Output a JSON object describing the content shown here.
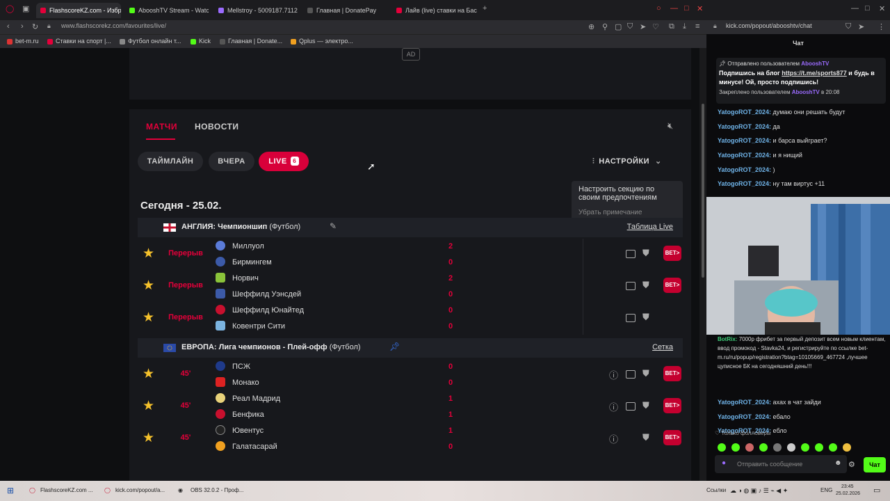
{
  "browser": {
    "tabs": [
      {
        "label": "FlashscoreKZ.com - Избр",
        "color": "#e4003a"
      },
      {
        "label": "AbooshTV Stream - Watc",
        "color": "#53fc18"
      },
      {
        "label": "Mellstroy - 5009187.71122",
        "color": "#9b6bff"
      },
      {
        "label": "Главная | DonatePay",
        "color": "#555"
      },
      {
        "label": "Лайв (live) ставки на Бас",
        "color": "#e4003a"
      }
    ],
    "address_left": "www.flashscorekz.com/favourites/live/",
    "address_right": "kick.com/popout/abooshtv/chat",
    "bookmarks": [
      {
        "label": "bet-m.ru",
        "color": "#d33"
      },
      {
        "label": "Ставки на спорт |...",
        "color": "#e4003a"
      },
      {
        "label": "Футбол онлайн т...",
        "color": "#888"
      },
      {
        "label": "Kick",
        "color": "#53fc18"
      },
      {
        "label": "Главная | Donate...",
        "color": "#555"
      },
      {
        "label": "Qplus — электро...",
        "color": "#f0a020"
      }
    ]
  },
  "site": {
    "ad_label": "AD",
    "nav": {
      "matches": "МАТЧИ",
      "news": "НОВОСТИ"
    },
    "filters": {
      "timeline": "ТАЙМЛАЙН",
      "yesterday": "ВЧЕРА",
      "live": "LIVE",
      "live_count": "6"
    },
    "settings_label": "НАСТРОЙКИ",
    "tooltip": {
      "text": "Настроить секцию по своим предпочтениям",
      "dismiss": "Убрать примечание"
    },
    "date_heading": "Сегодня - 25.02.",
    "leagues": [
      {
        "country": "АНГЛИЯ:",
        "name": "Чемпионшип",
        "sport": "(Футбол)",
        "link": "Таблица Live",
        "matches": [
          {
            "status": "Перерыв",
            "home": "Миллуол",
            "away": "Бирмингем",
            "home_score": "2",
            "away_score": "0",
            "bet": "BET>"
          },
          {
            "status": "Перерыв",
            "home": "Норвич",
            "away": "Шеффилд Уэнсдей",
            "home_score": "2",
            "away_score": "0",
            "bet": "BET>"
          },
          {
            "status": "Перерыв",
            "home": "Шеффилд Юнайтед",
            "away": "Ковентри Сити",
            "home_score": "0",
            "away_score": "0",
            "bet": ""
          }
        ]
      },
      {
        "country": "ЕВРОПА:",
        "name": "Лига чемпионов - Плей-офф",
        "sport": "(Футбол)",
        "link": "Сетка",
        "matches": [
          {
            "status": "45'",
            "home": "ПСЖ",
            "away": "Монако",
            "home_score": "0",
            "away_score": "0",
            "bet": "BET>"
          },
          {
            "status": "45'",
            "home": "Реал Мадрид",
            "away": "Бенфика",
            "home_score": "1",
            "away_score": "1",
            "bet": "BET>"
          },
          {
            "status": "45'",
            "home": "Ювентус",
            "away": "Галатасарай",
            "home_score": "1",
            "away_score": "0",
            "bet": "BET>"
          }
        ]
      }
    ]
  },
  "chat": {
    "title": "Чат",
    "pinned": {
      "sent_by": "Отправлено пользователем",
      "sent_user": "AbooshTV",
      "text_before": "Подпишись на блог",
      "link": "https://t.me/sports877",
      "text_after": "и будь в минусе! Ой, просто подпишись!",
      "pinned_by": "Закреплено пользователем",
      "pinned_user": "AbooshTV",
      "pinned_time": "в 20:08"
    },
    "messages_top": [
      {
        "user": "YatogoROT_2024:",
        "text": "думаю они решать будут"
      },
      {
        "user": "YatogoROT_2024:",
        "text": "да"
      },
      {
        "user": "YatogoROT_2024:",
        "text": "и барса выйграет?"
      },
      {
        "user": "YatogoROT_2024:",
        "text": "и я нищий"
      },
      {
        "user": "YatogoROT_2024:",
        "text": ")"
      },
      {
        "user": "YatogoROT_2024:",
        "text": "ну там виртус +11"
      }
    ],
    "bot": {
      "user": "BotRix:",
      "text": "7000р фрибет за первый депозит всем новым клиентам, ввод промокод - Stavka24, и регистрируйте по ссылке bet-m.ru/ru/popup/registration?btag=10105669_467724 ,лучшее цуписное БК на сегодняшний день!!!"
    },
    "messages_bottom": [
      {
        "user": "YatogoROT_2024:",
        "text": "ахах в чат зайди"
      },
      {
        "user": "YatogoROT_2024:",
        "text": "ебало"
      },
      {
        "user": "YatogoROT_2024:",
        "text": "ебло"
      }
    ],
    "followers_only": "Только фолловеры",
    "input_placeholder": "Отправить сообщение",
    "send_label": "Чат"
  },
  "taskbar": {
    "items": [
      "FlashscoreKZ.com ...",
      "kick.com/popout/a...",
      "OBS 32.0.2 - Проф..."
    ],
    "links_label": "Ссылки",
    "lang": "ENG",
    "time": "23:45",
    "date": "25.02.2026"
  }
}
